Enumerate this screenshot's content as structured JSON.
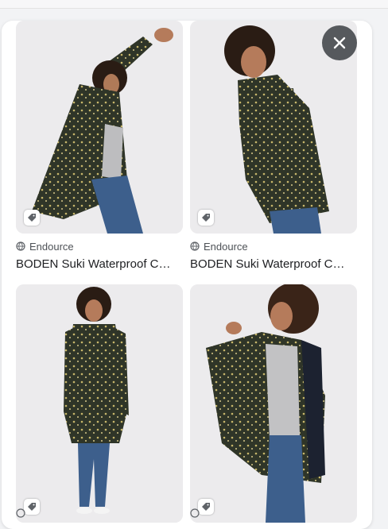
{
  "results": [
    {
      "source": "Endource",
      "title": "BODEN Suki Waterproof C…"
    },
    {
      "source": "Endource",
      "title": "BODEN Suki Waterproof C…"
    }
  ],
  "icons": {
    "close": "close-icon",
    "tag": "price-tag-icon",
    "globe": "globe-icon"
  },
  "colors": {
    "coat": "#2f3528",
    "coat_dots": "#c8b76a",
    "jeans": "#3d5f8c",
    "background": "#ecebed",
    "close_button": "#3c4043"
  }
}
